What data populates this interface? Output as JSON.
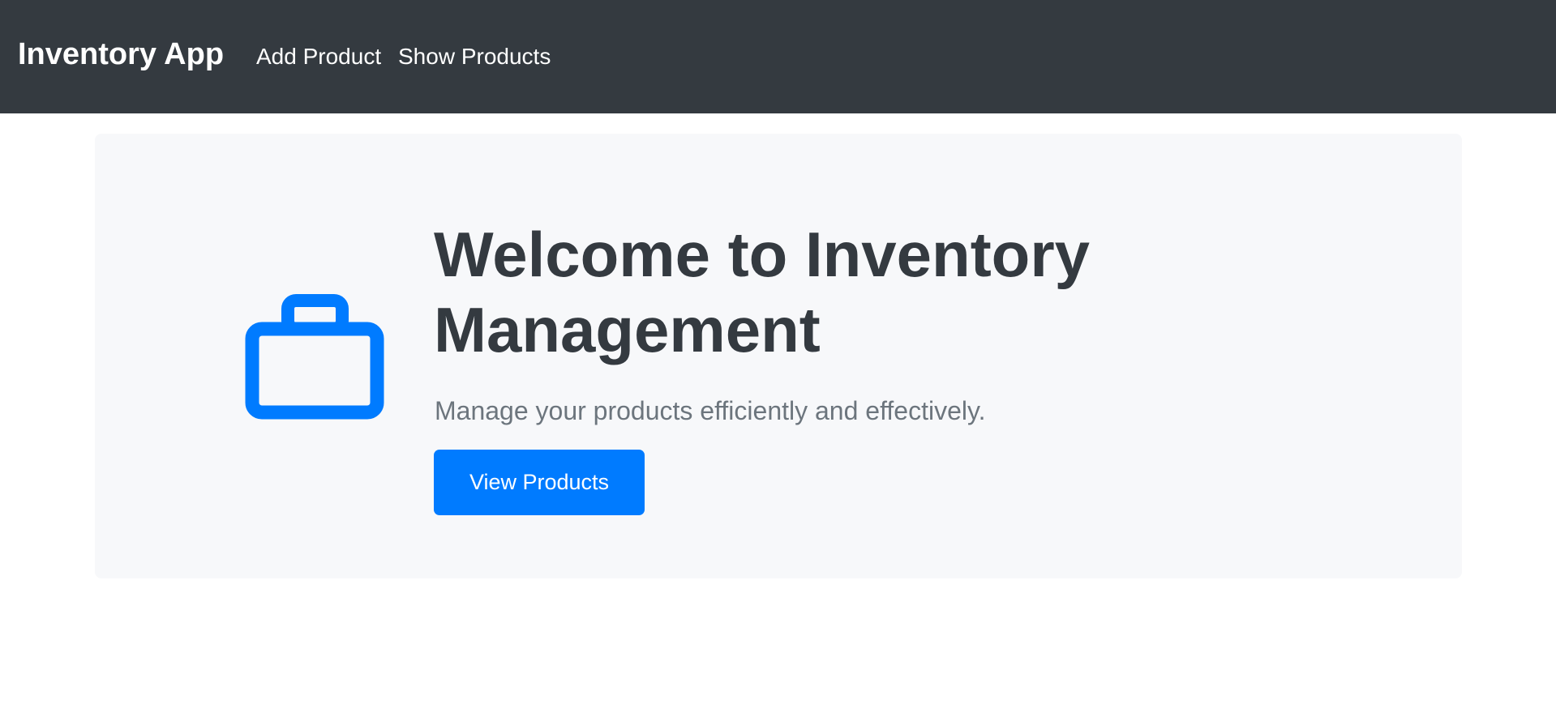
{
  "navbar": {
    "brand": "Inventory App",
    "links": [
      {
        "label": "Add Product"
      },
      {
        "label": "Show Products"
      }
    ]
  },
  "hero": {
    "icon": "briefcase-icon",
    "title": "Welcome to Inventory Management",
    "lead": "Manage your products efficiently and effectively.",
    "button_label": "View Products"
  },
  "colors": {
    "navbar_bg": "#343a40",
    "jumbotron_bg": "#f7f8fa",
    "primary": "#007bff",
    "title_text": "#343a40",
    "lead_text": "#6c757d"
  }
}
